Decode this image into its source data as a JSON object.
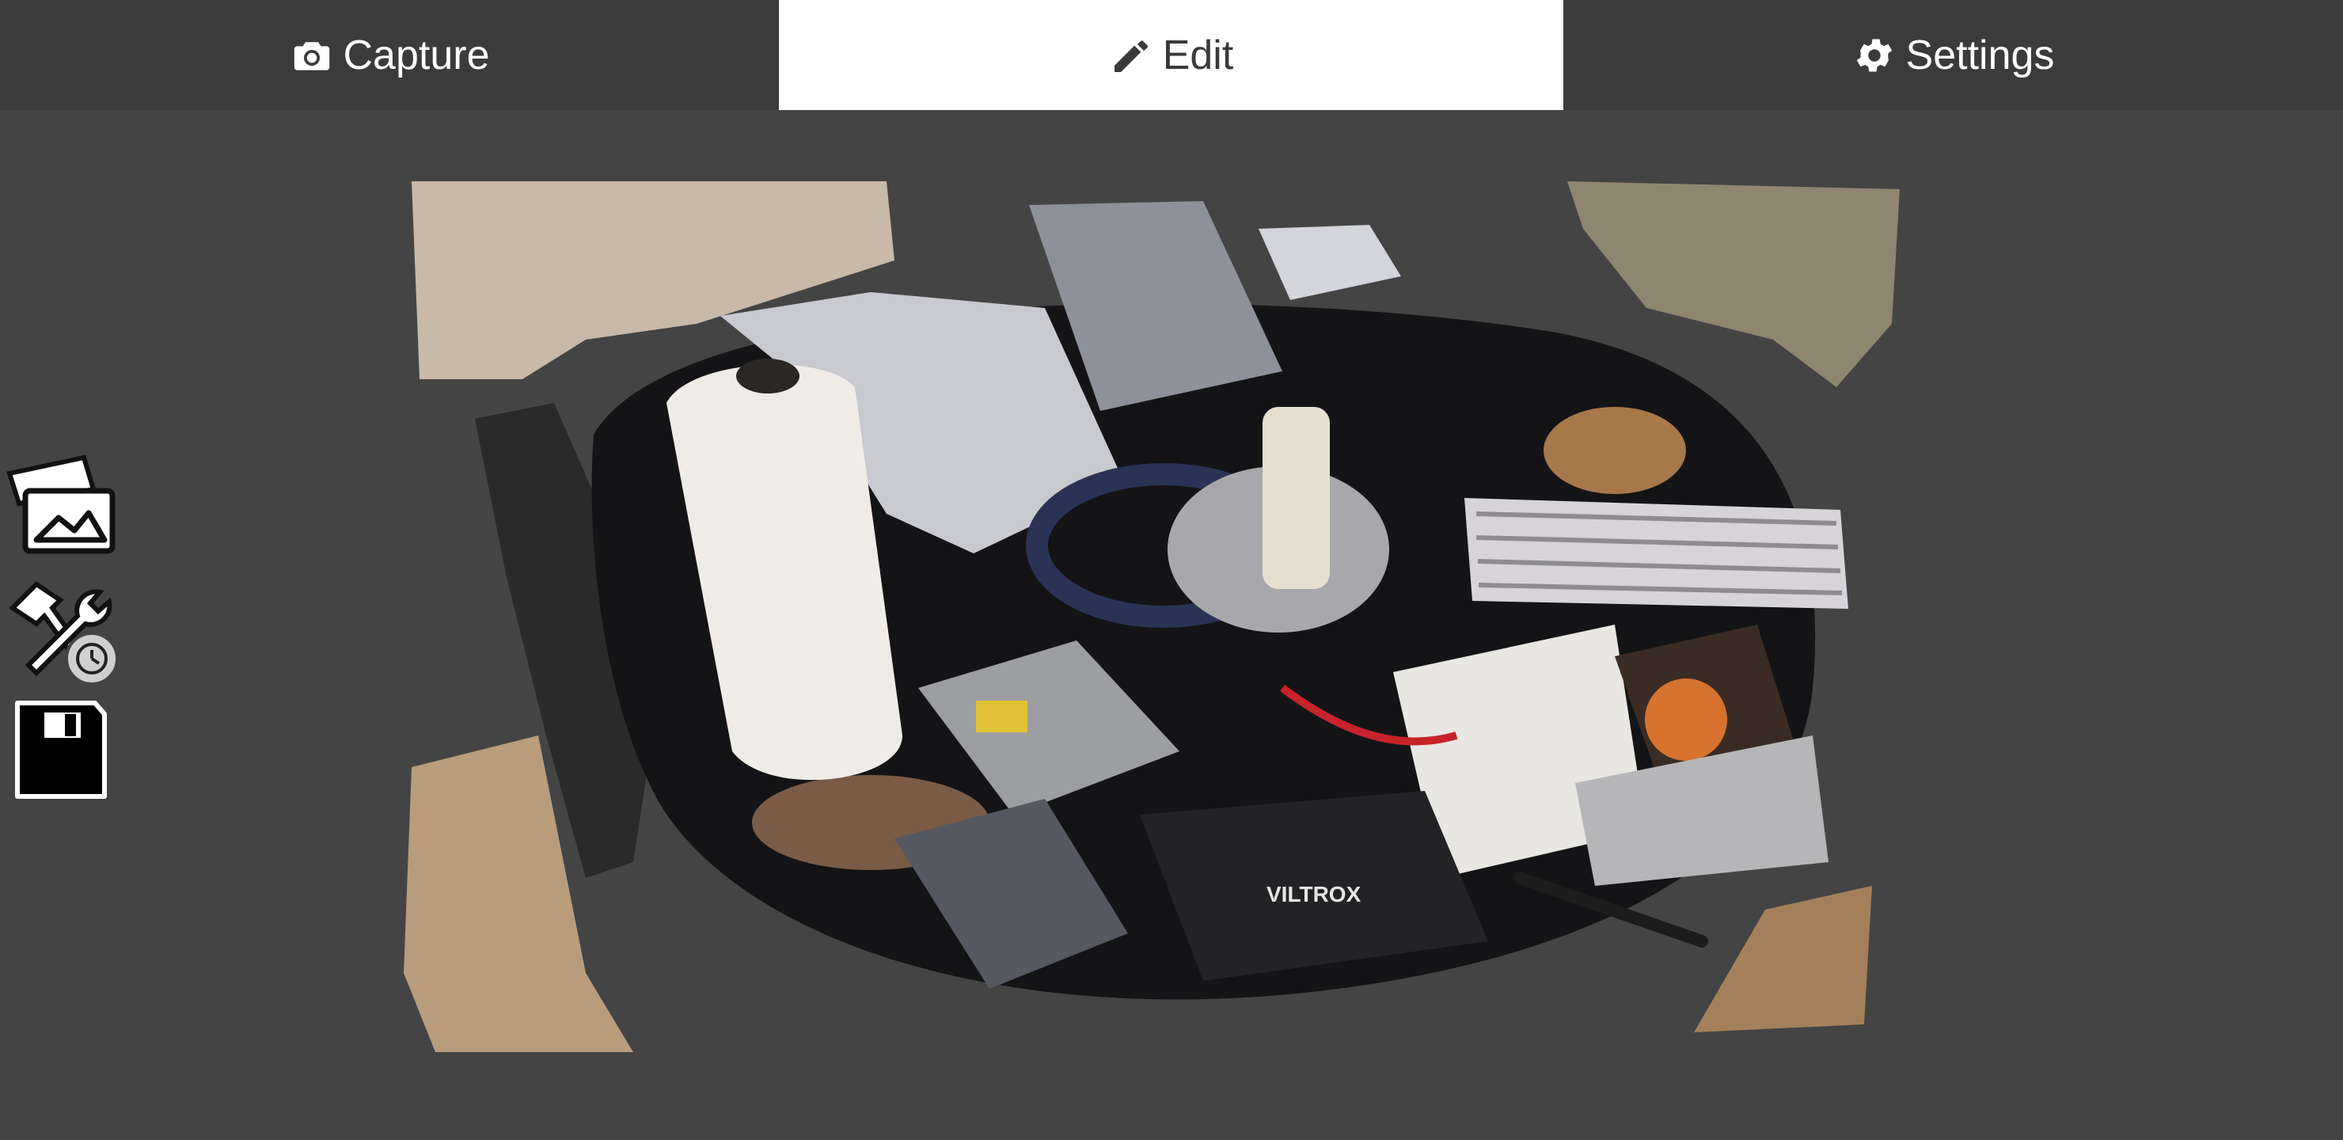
{
  "tabs": [
    {
      "label": "Capture",
      "icon": "camera-icon",
      "active": false
    },
    {
      "label": "Edit",
      "icon": "pencil-icon",
      "active": true
    },
    {
      "label": "Settings",
      "icon": "gear-icon",
      "active": false
    }
  ],
  "scan": {
    "product_label": "VILTROX"
  },
  "side_tools": [
    {
      "icon": "gallery-icon"
    },
    {
      "icon": "tools-icon"
    },
    {
      "icon": "save-icon"
    }
  ],
  "colors": {
    "background": "#444444",
    "tab_bar": "#3b3b3c",
    "active_tab": "#ffffff",
    "tab_text": "#ffffff",
    "active_tab_text": "#3a3a3a"
  }
}
